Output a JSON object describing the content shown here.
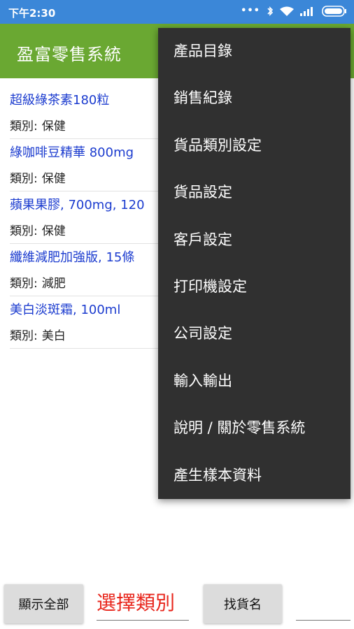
{
  "status_bar": {
    "time": "下午2:30"
  },
  "app_bar": {
    "title": "盈富零售系統"
  },
  "products": [
    {
      "name": "超級綠茶素180粒",
      "category_label": "類別:",
      "category": "保健"
    },
    {
      "name": "綠咖啡豆精華 800mg",
      "category_label": "類別:",
      "category": "保健"
    },
    {
      "name": "蘋果果膠, 700mg, 120",
      "category_label": "類別:",
      "category": "保健"
    },
    {
      "name": "纖維減肥加強版, 15條",
      "category_label": "類別:",
      "category": "減肥"
    },
    {
      "name": "美白淡斑霜, 100ml",
      "category_label": "類別:",
      "category": "美白"
    }
  ],
  "menu": {
    "items": [
      "產品目錄",
      "銷售紀錄",
      "貨品類別設定",
      "貨品設定",
      "客戶設定",
      "打印機設定",
      "公司設定",
      "輸入輸出",
      "說明 / 關於零售系統",
      "產生樣本資料"
    ]
  },
  "bottom_bar": {
    "show_all_label": "顯示全部",
    "category_select_label": "選擇類別",
    "find_label": "找貨名",
    "search_value": ""
  },
  "colors": {
    "status_bar": "#3b87d8",
    "app_bar": "#6aa832",
    "product_name": "#1c3ccf",
    "category_select": "#e8261c",
    "menu_bg": "#303030"
  }
}
